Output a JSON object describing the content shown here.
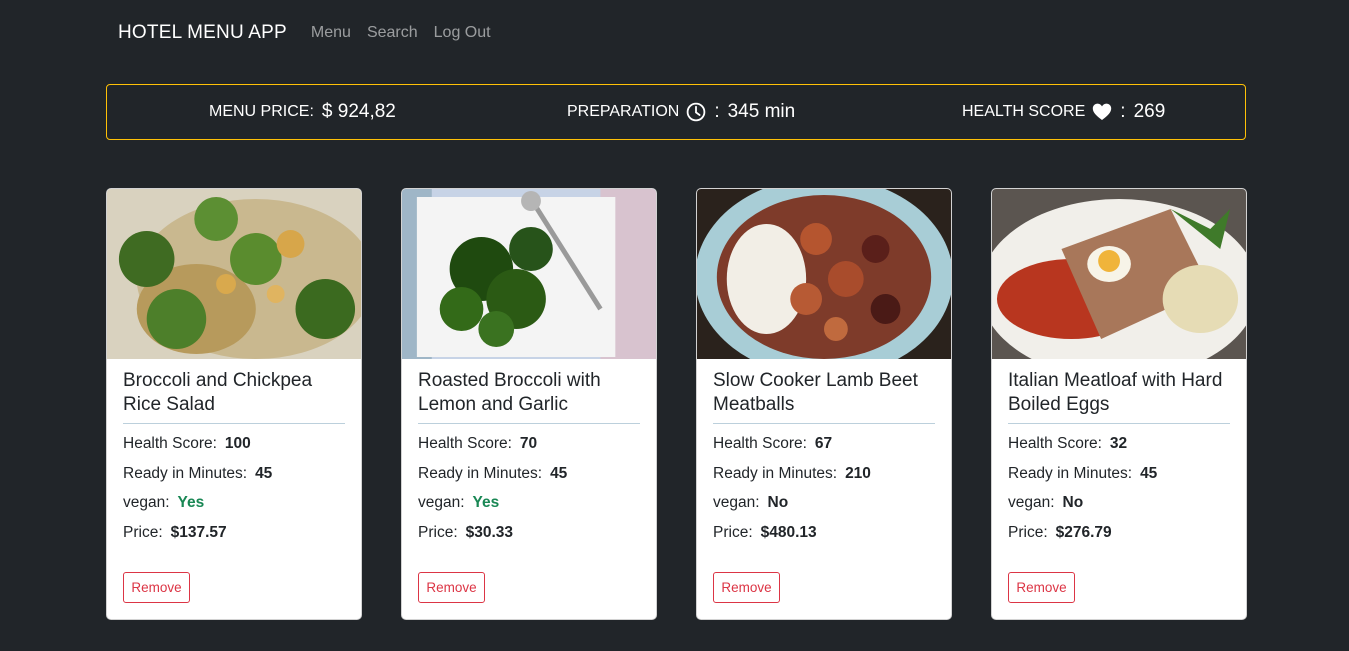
{
  "nav": {
    "brand": "HOTEL MENU APP",
    "links": [
      "Menu",
      "Search",
      "Log Out"
    ]
  },
  "summary": {
    "price_label": "MENU PRICE:",
    "price_value": "$ 924,82",
    "prep_label": "PREPARATION",
    "prep_sep": ":",
    "prep_value": "345 min",
    "health_label": "HEALTH SCORE",
    "health_sep": ":",
    "health_value": "269",
    "icons": [
      "clock-icon",
      "heart-icon"
    ],
    "accent_color": "#ffc107"
  },
  "card_labels": {
    "health": "Health Score:",
    "ready": "Ready in Minutes:",
    "vegan": "vegan:",
    "price": "Price:",
    "remove": "Remove"
  },
  "cards": [
    {
      "title": "Broccoli and Chickpea Rice Salad",
      "health": "100",
      "ready": "45",
      "vegan": "Yes",
      "price": "$137.57"
    },
    {
      "title": "Roasted Broccoli with Lemon and Garlic",
      "health": "70",
      "ready": "45",
      "vegan": "Yes",
      "price": "$30.33"
    },
    {
      "title": "Slow Cooker Lamb Beet Meatballs",
      "health": "67",
      "ready": "210",
      "vegan": "No",
      "price": "$480.13"
    },
    {
      "title": "Italian Meatloaf with Hard Boiled Eggs",
      "health": "32",
      "ready": "45",
      "vegan": "No",
      "price": "$276.79"
    }
  ],
  "colors": {
    "background": "#212529",
    "success": "#198754",
    "danger": "#dc3545"
  }
}
